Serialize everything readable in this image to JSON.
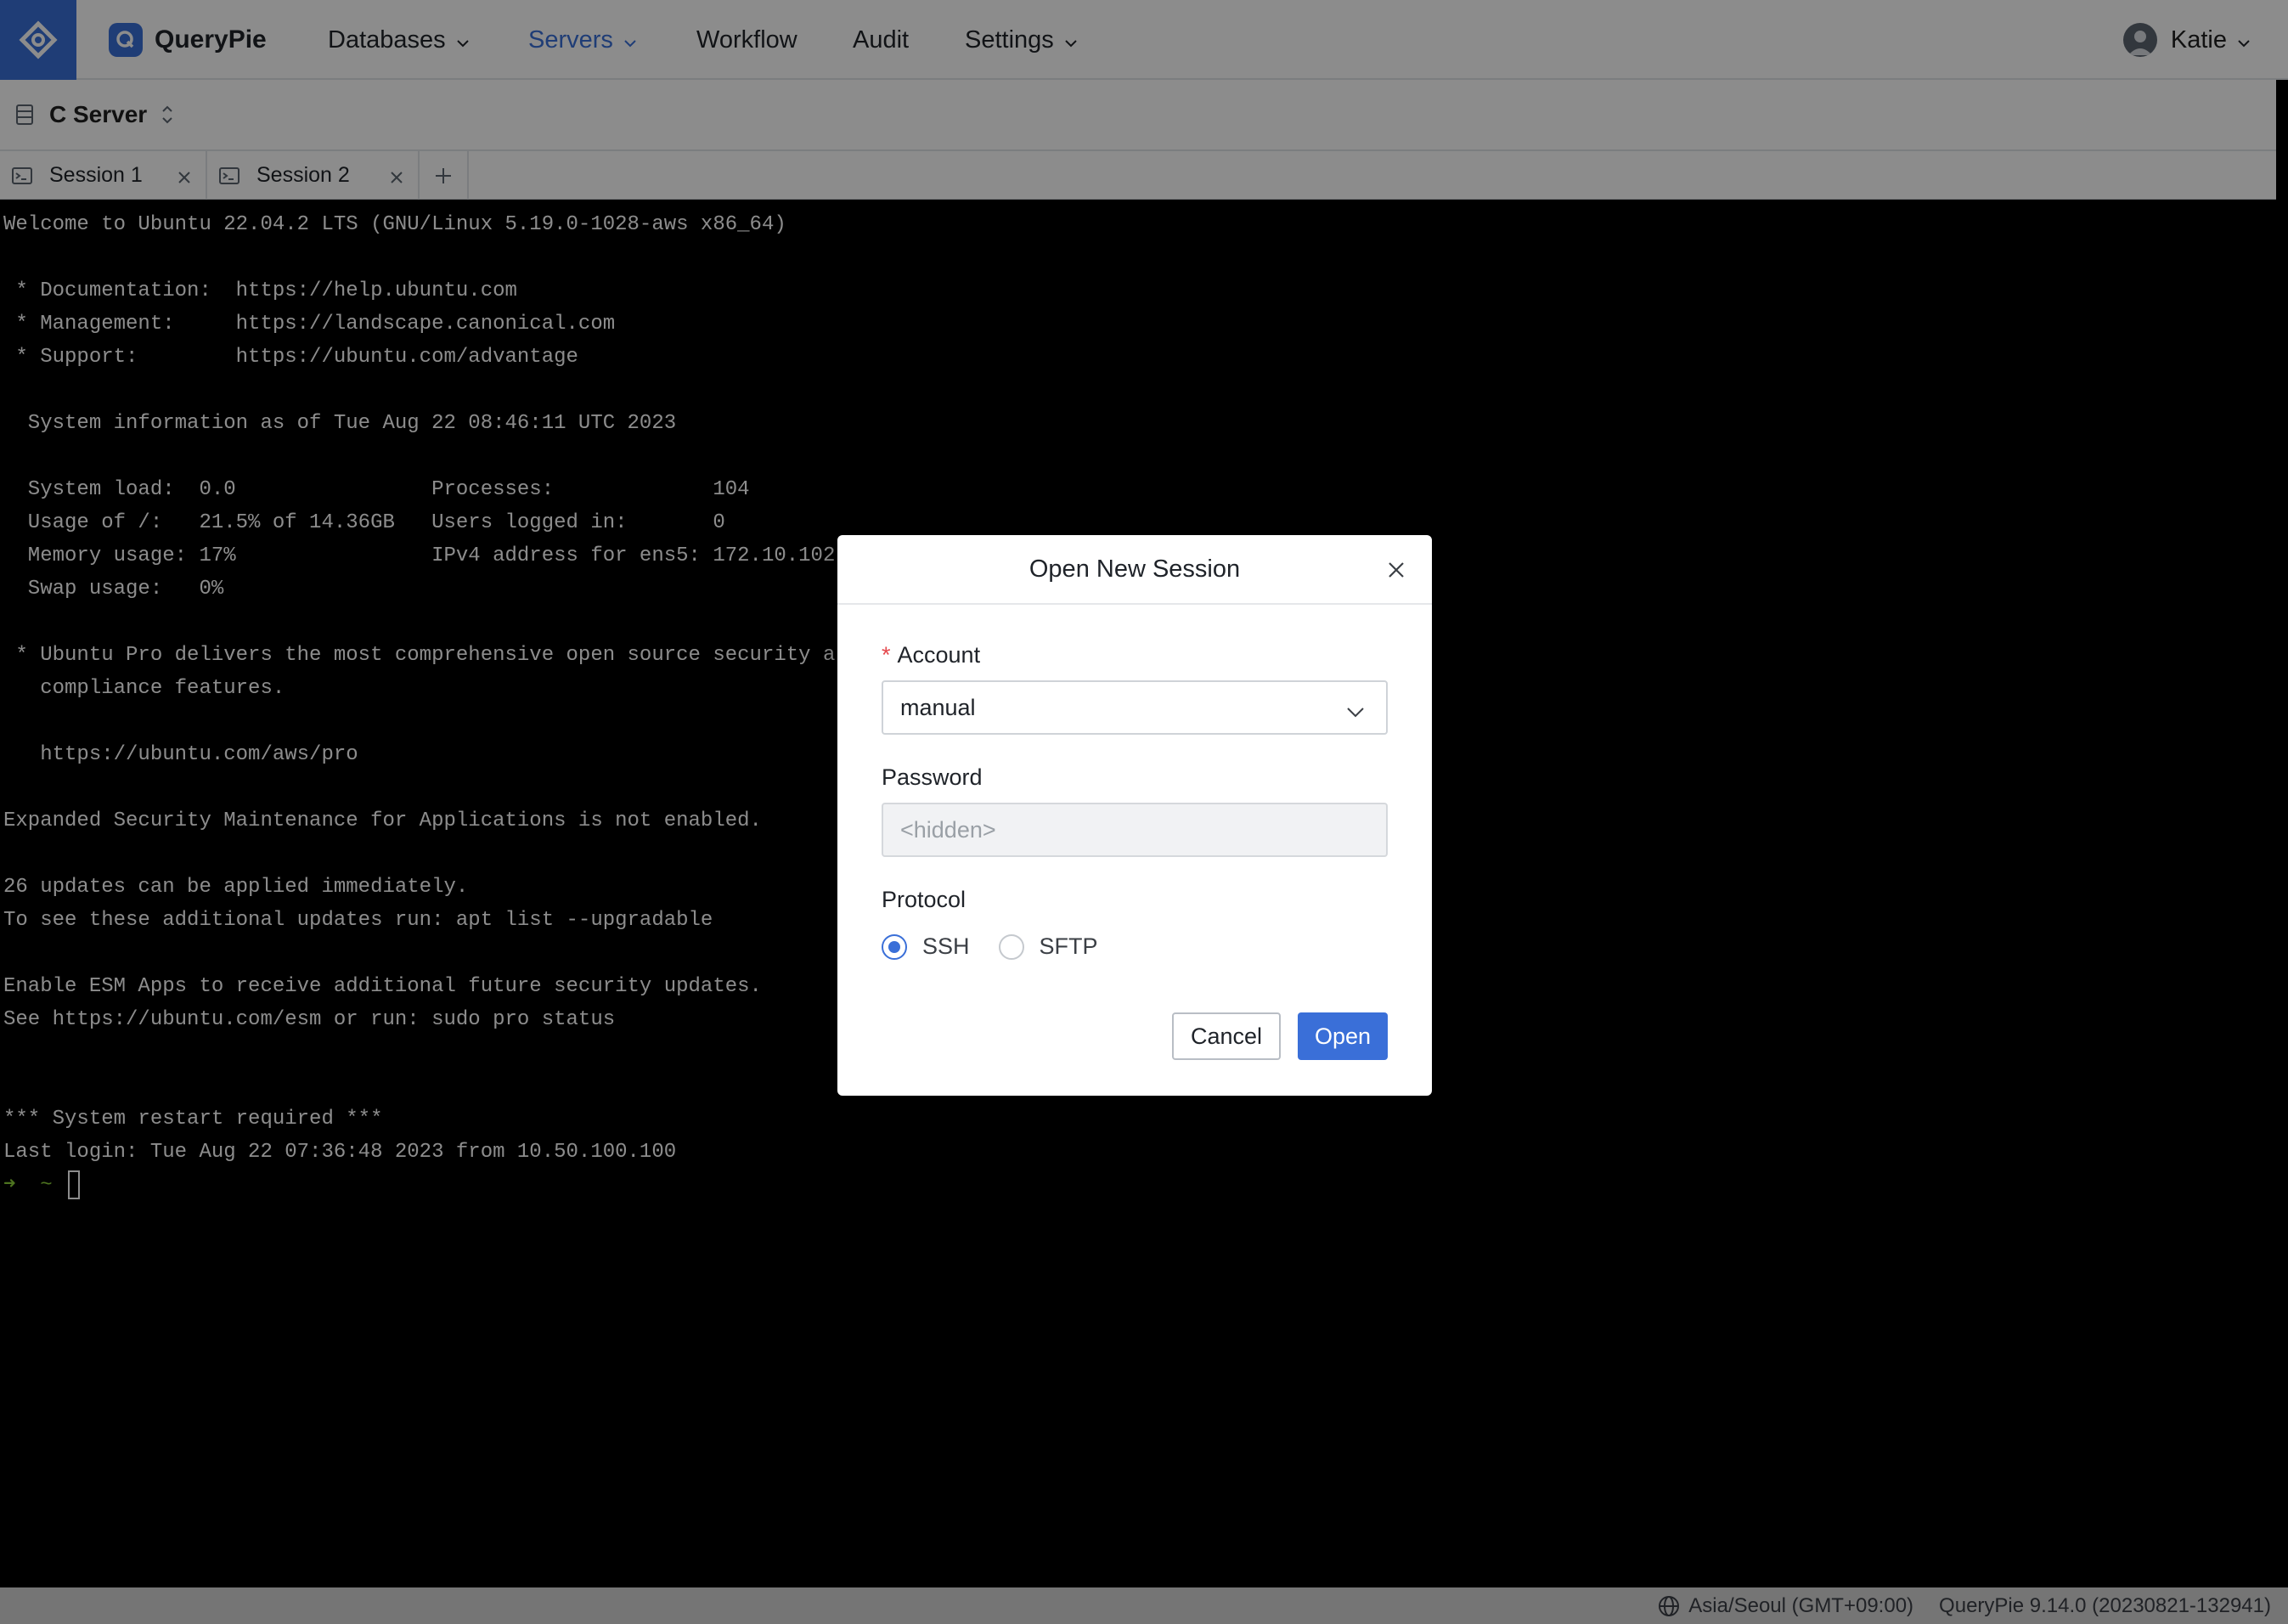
{
  "app": {
    "brand": "QueryPie"
  },
  "nav": {
    "items": [
      {
        "label": "Databases",
        "has_dropdown": true,
        "active": false
      },
      {
        "label": "Servers",
        "has_dropdown": true,
        "active": true
      },
      {
        "label": "Workflow",
        "has_dropdown": false,
        "active": false
      },
      {
        "label": "Audit",
        "has_dropdown": false,
        "active": false
      },
      {
        "label": "Settings",
        "has_dropdown": true,
        "active": false
      }
    ],
    "user": "Katie"
  },
  "server": {
    "name": "C Server"
  },
  "tabs": [
    {
      "label": "Session 1"
    },
    {
      "label": "Session 2"
    }
  ],
  "terminal": {
    "lines": [
      "Welcome to Ubuntu 22.04.2 LTS (GNU/Linux 5.19.0-1028-aws x86_64)",
      "",
      " * Documentation:  https://help.ubuntu.com",
      " * Management:     https://landscape.canonical.com",
      " * Support:        https://ubuntu.com/advantage",
      "",
      "  System information as of Tue Aug 22 08:46:11 UTC 2023",
      "",
      "  System load:  0.0                Processes:             104",
      "  Usage of /:   21.5% of 14.36GB   Users logged in:       0",
      "  Memory usage: 17%                IPv4 address for ens5: 172.10.102",
      "  Swap usage:   0%",
      "",
      " * Ubuntu Pro delivers the most comprehensive open source security a",
      "   compliance features.",
      "",
      "   https://ubuntu.com/aws/pro",
      "",
      "Expanded Security Maintenance for Applications is not enabled.",
      "",
      "26 updates can be applied immediately.",
      "To see these additional updates run: apt list --upgradable",
      "",
      "Enable ESM Apps to receive additional future security updates.",
      "See https://ubuntu.com/esm or run: sudo pro status",
      "",
      "",
      "*** System restart required ***",
      "Last login: Tue Aug 22 07:36:48 2023 from 10.50.100.100"
    ],
    "prompt_arrow": "➜",
    "prompt_dir": "~"
  },
  "modal": {
    "title": "Open New Session",
    "account_label": "Account",
    "account_required_mark": "*",
    "account_value": "manual",
    "password_label": "Password",
    "password_placeholder": "<hidden>",
    "protocol_label": "Protocol",
    "protocol_options": [
      {
        "label": "SSH",
        "selected": true
      },
      {
        "label": "SFTP",
        "selected": false
      }
    ],
    "cancel_label": "Cancel",
    "open_label": "Open"
  },
  "status": {
    "timezone": "Asia/Seoul (GMT+09:00)",
    "version": "QueryPie 9.14.0 (20230821-132941)"
  },
  "colors": {
    "accent": "#3a6fd8",
    "terminal_bg": "#000000",
    "prompt_green": "#8cd23a"
  }
}
